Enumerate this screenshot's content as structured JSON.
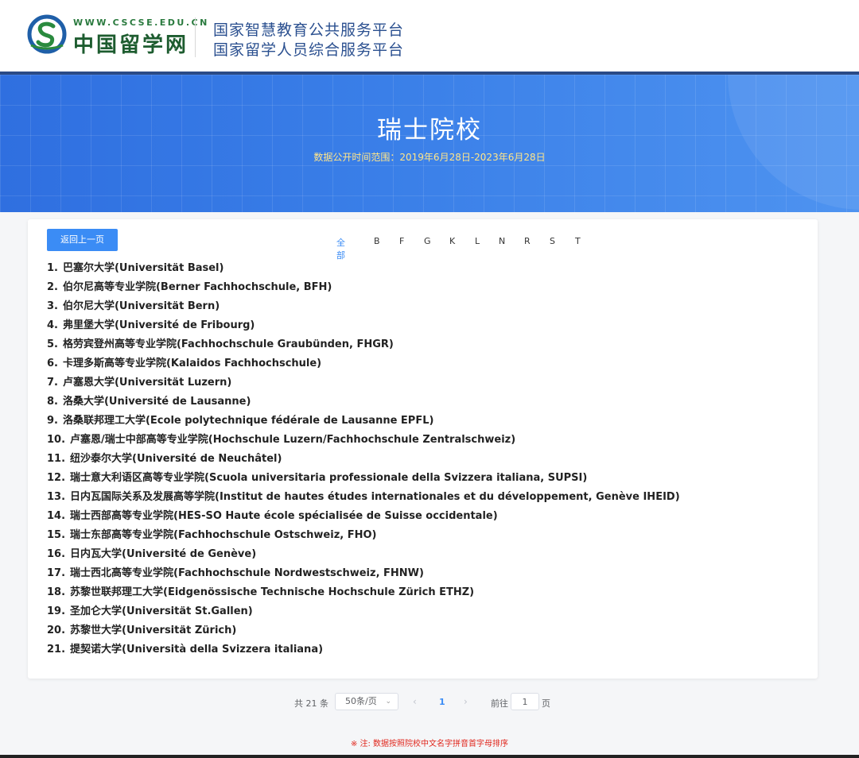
{
  "header": {
    "logo_url": "WWW.CSCSE.EDU.CN",
    "logo_name": "中国留学网",
    "platform_line1": "国家智慧教育公共服务平台",
    "platform_line2": "国家留学人员综合服务平台"
  },
  "banner": {
    "title": "瑞士院校",
    "subtitle": "数据公开时间范围：2019年6月28日-2023年6月28日"
  },
  "back_button_label": "返回上一页",
  "letter_filter": [
    "全部",
    "B",
    "F",
    "G",
    "K",
    "L",
    "N",
    "R",
    "S",
    "T"
  ],
  "letter_filter_active": "全部",
  "universities": [
    "巴塞尔大学(Universität Basel)",
    "伯尔尼高等专业学院(Berner Fachhochschule, BFH)",
    "伯尔尼大学(Universität Bern)",
    "弗里堡大学(Université de Fribourg)",
    "格劳宾登州高等专业学院(Fachhochschule Graubünden, FHGR)",
    "卡理多斯高等专业学院(Kalaidos Fachhochschule)",
    "卢塞恩大学(Universität Luzern)",
    "洛桑大学(Université de Lausanne)",
    "洛桑联邦理工大学(Ecole polytechnique fédérale de Lausanne EPFL)",
    "卢塞恩/瑞士中部高等专业学院(Hochschule Luzern/Fachhochschule Zentralschweiz)",
    "纽沙泰尔大学(Université de Neuchâtel)",
    "瑞士意大利语区高等专业学院(Scuola universitaria professionale della Svizzera italiana, SUPSI)",
    "日内瓦国际关系及发展高等学院(Institut de hautes études internationales et du développement, Genève IHEID)",
    "瑞士西部高等专业学院(HES-SO Haute école spécialisée de Suisse occidentale)",
    "瑞士东部高等专业学院(Fachhochschule Ostschweiz, FHO)",
    "日内瓦大学(Université de Genève)",
    "瑞士西北高等专业学院(Fachhochschule Nordwestschweiz, FHNW)",
    "苏黎世联邦理工大学(Eidgenössische Technische Hochschule Zürich ETHZ)",
    "圣加仑大学(Universität St.Gallen)",
    "苏黎世大学(Universität Zürich)",
    "提契诺大学(Università della Svizzera italiana)"
  ],
  "pagination": {
    "total": "共 21 条",
    "page_size": "50条/页",
    "prev_icon": "chevron-left-icon",
    "current_page": "1",
    "next_icon": "chevron-right-icon",
    "goto_label": "前往",
    "goto_value": "1",
    "goto_unit": "页"
  },
  "note": "※ 注: 数据按照院校中文名字拼音首字母排序",
  "colors": {
    "accent": "#3b8cf5",
    "banner": "#3a7fe8",
    "header_text": "#2a4f8f",
    "note": "#e0261c"
  }
}
